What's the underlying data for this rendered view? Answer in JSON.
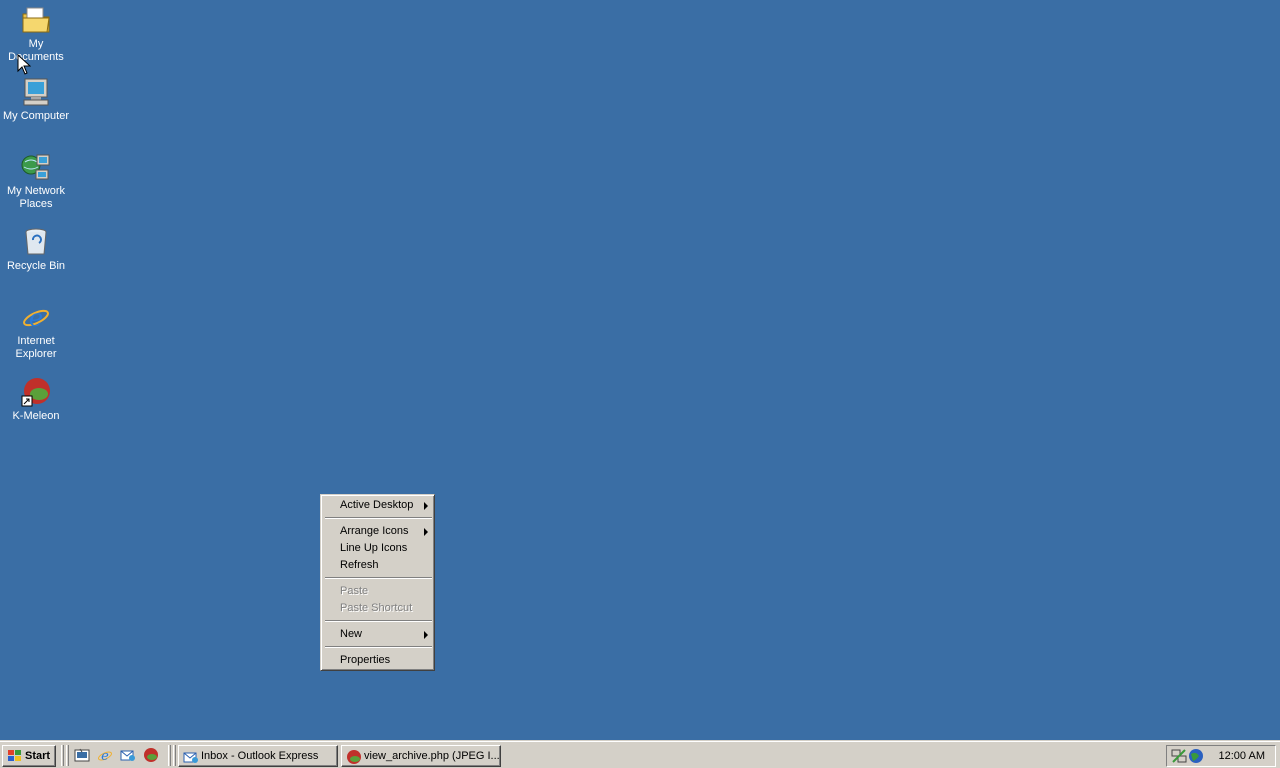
{
  "desktop": {
    "icons": [
      {
        "label": "My Documents",
        "icon": "folder-documents-icon"
      },
      {
        "label": "My Computer",
        "icon": "computer-icon"
      },
      {
        "label": "My Network Places",
        "icon": "network-places-icon"
      },
      {
        "label": "Recycle Bin",
        "icon": "recycle-bin-icon"
      },
      {
        "label": "Internet Explorer",
        "icon": "internet-explorer-icon"
      },
      {
        "label": "K-Meleon",
        "icon": "k-meleon-icon"
      }
    ],
    "background_color": "#3a6ea5"
  },
  "context_menu": {
    "items": [
      {
        "label": "Active Desktop",
        "submenu": true,
        "enabled": true
      },
      {
        "label": "Arrange Icons",
        "submenu": true,
        "enabled": true
      },
      {
        "label": "Line Up Icons",
        "submenu": false,
        "enabled": true
      },
      {
        "label": "Refresh",
        "submenu": false,
        "enabled": true
      },
      {
        "label": "Paste",
        "submenu": false,
        "enabled": false
      },
      {
        "label": "Paste Shortcut",
        "submenu": false,
        "enabled": false
      },
      {
        "label": "New",
        "submenu": true,
        "enabled": true
      },
      {
        "label": "Properties",
        "submenu": false,
        "enabled": true
      }
    ]
  },
  "taskbar": {
    "start_label": "Start",
    "quick_launch": [
      "show-desktop-icon",
      "internet-explorer-icon",
      "outlook-express-icon",
      "k-meleon-icon"
    ],
    "tasks": [
      {
        "label": "Inbox - Outlook Express",
        "icon": "outlook-express-icon"
      },
      {
        "label": "view_archive.php (JPEG I...",
        "icon": "k-meleon-icon"
      }
    ],
    "tray_icons": [
      "network-connection-icon",
      "network-globe-icon"
    ],
    "clock": "12:00 AM"
  }
}
